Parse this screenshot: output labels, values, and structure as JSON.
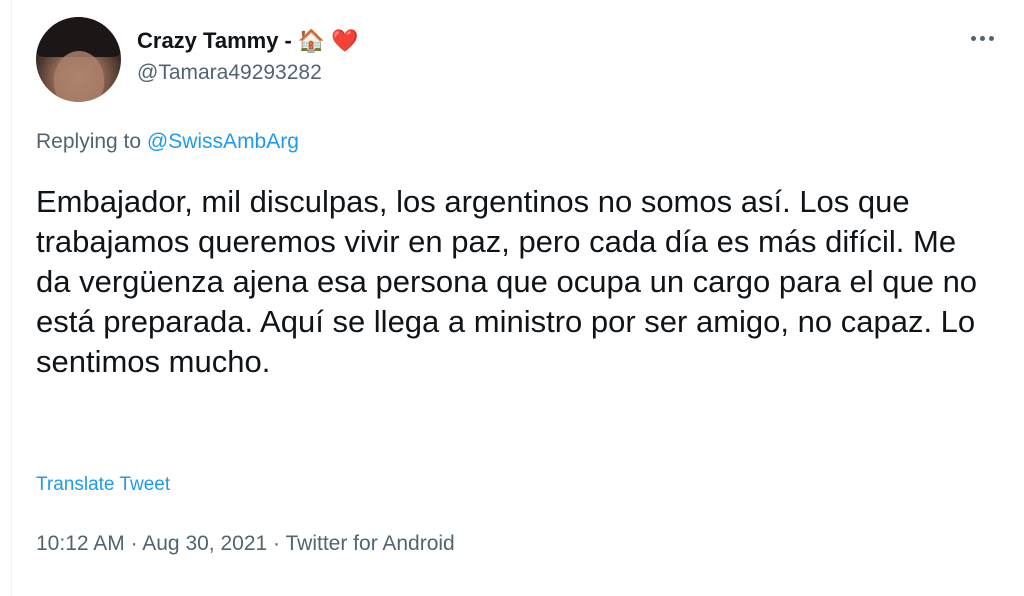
{
  "author": {
    "display_name": "Crazy Tammy -",
    "emoji_1": "🏠",
    "emoji_2": "❤️",
    "handle": "@Tamara49293282"
  },
  "reply": {
    "prefix": "Replying to ",
    "mention": "@SwissAmbArg"
  },
  "tweet": {
    "text": "Embajador, mil disculpas, los argentinos no somos así. Los que trabajamos queremos vivir en paz, pero cada día es más difícil. Me da vergüenza ajena esa persona que ocupa un cargo para el que no está preparada. Aquí se llega a ministro por ser amigo, no capaz. Lo sentimos mucho.",
    "translate_label": "Translate Tweet"
  },
  "meta": {
    "time": "10:12 AM",
    "sep1": " · ",
    "date": "Aug 30, 2021",
    "sep2": " · ",
    "source": "Twitter for Android"
  },
  "icons": {
    "more": "more-horizontal-icon"
  }
}
